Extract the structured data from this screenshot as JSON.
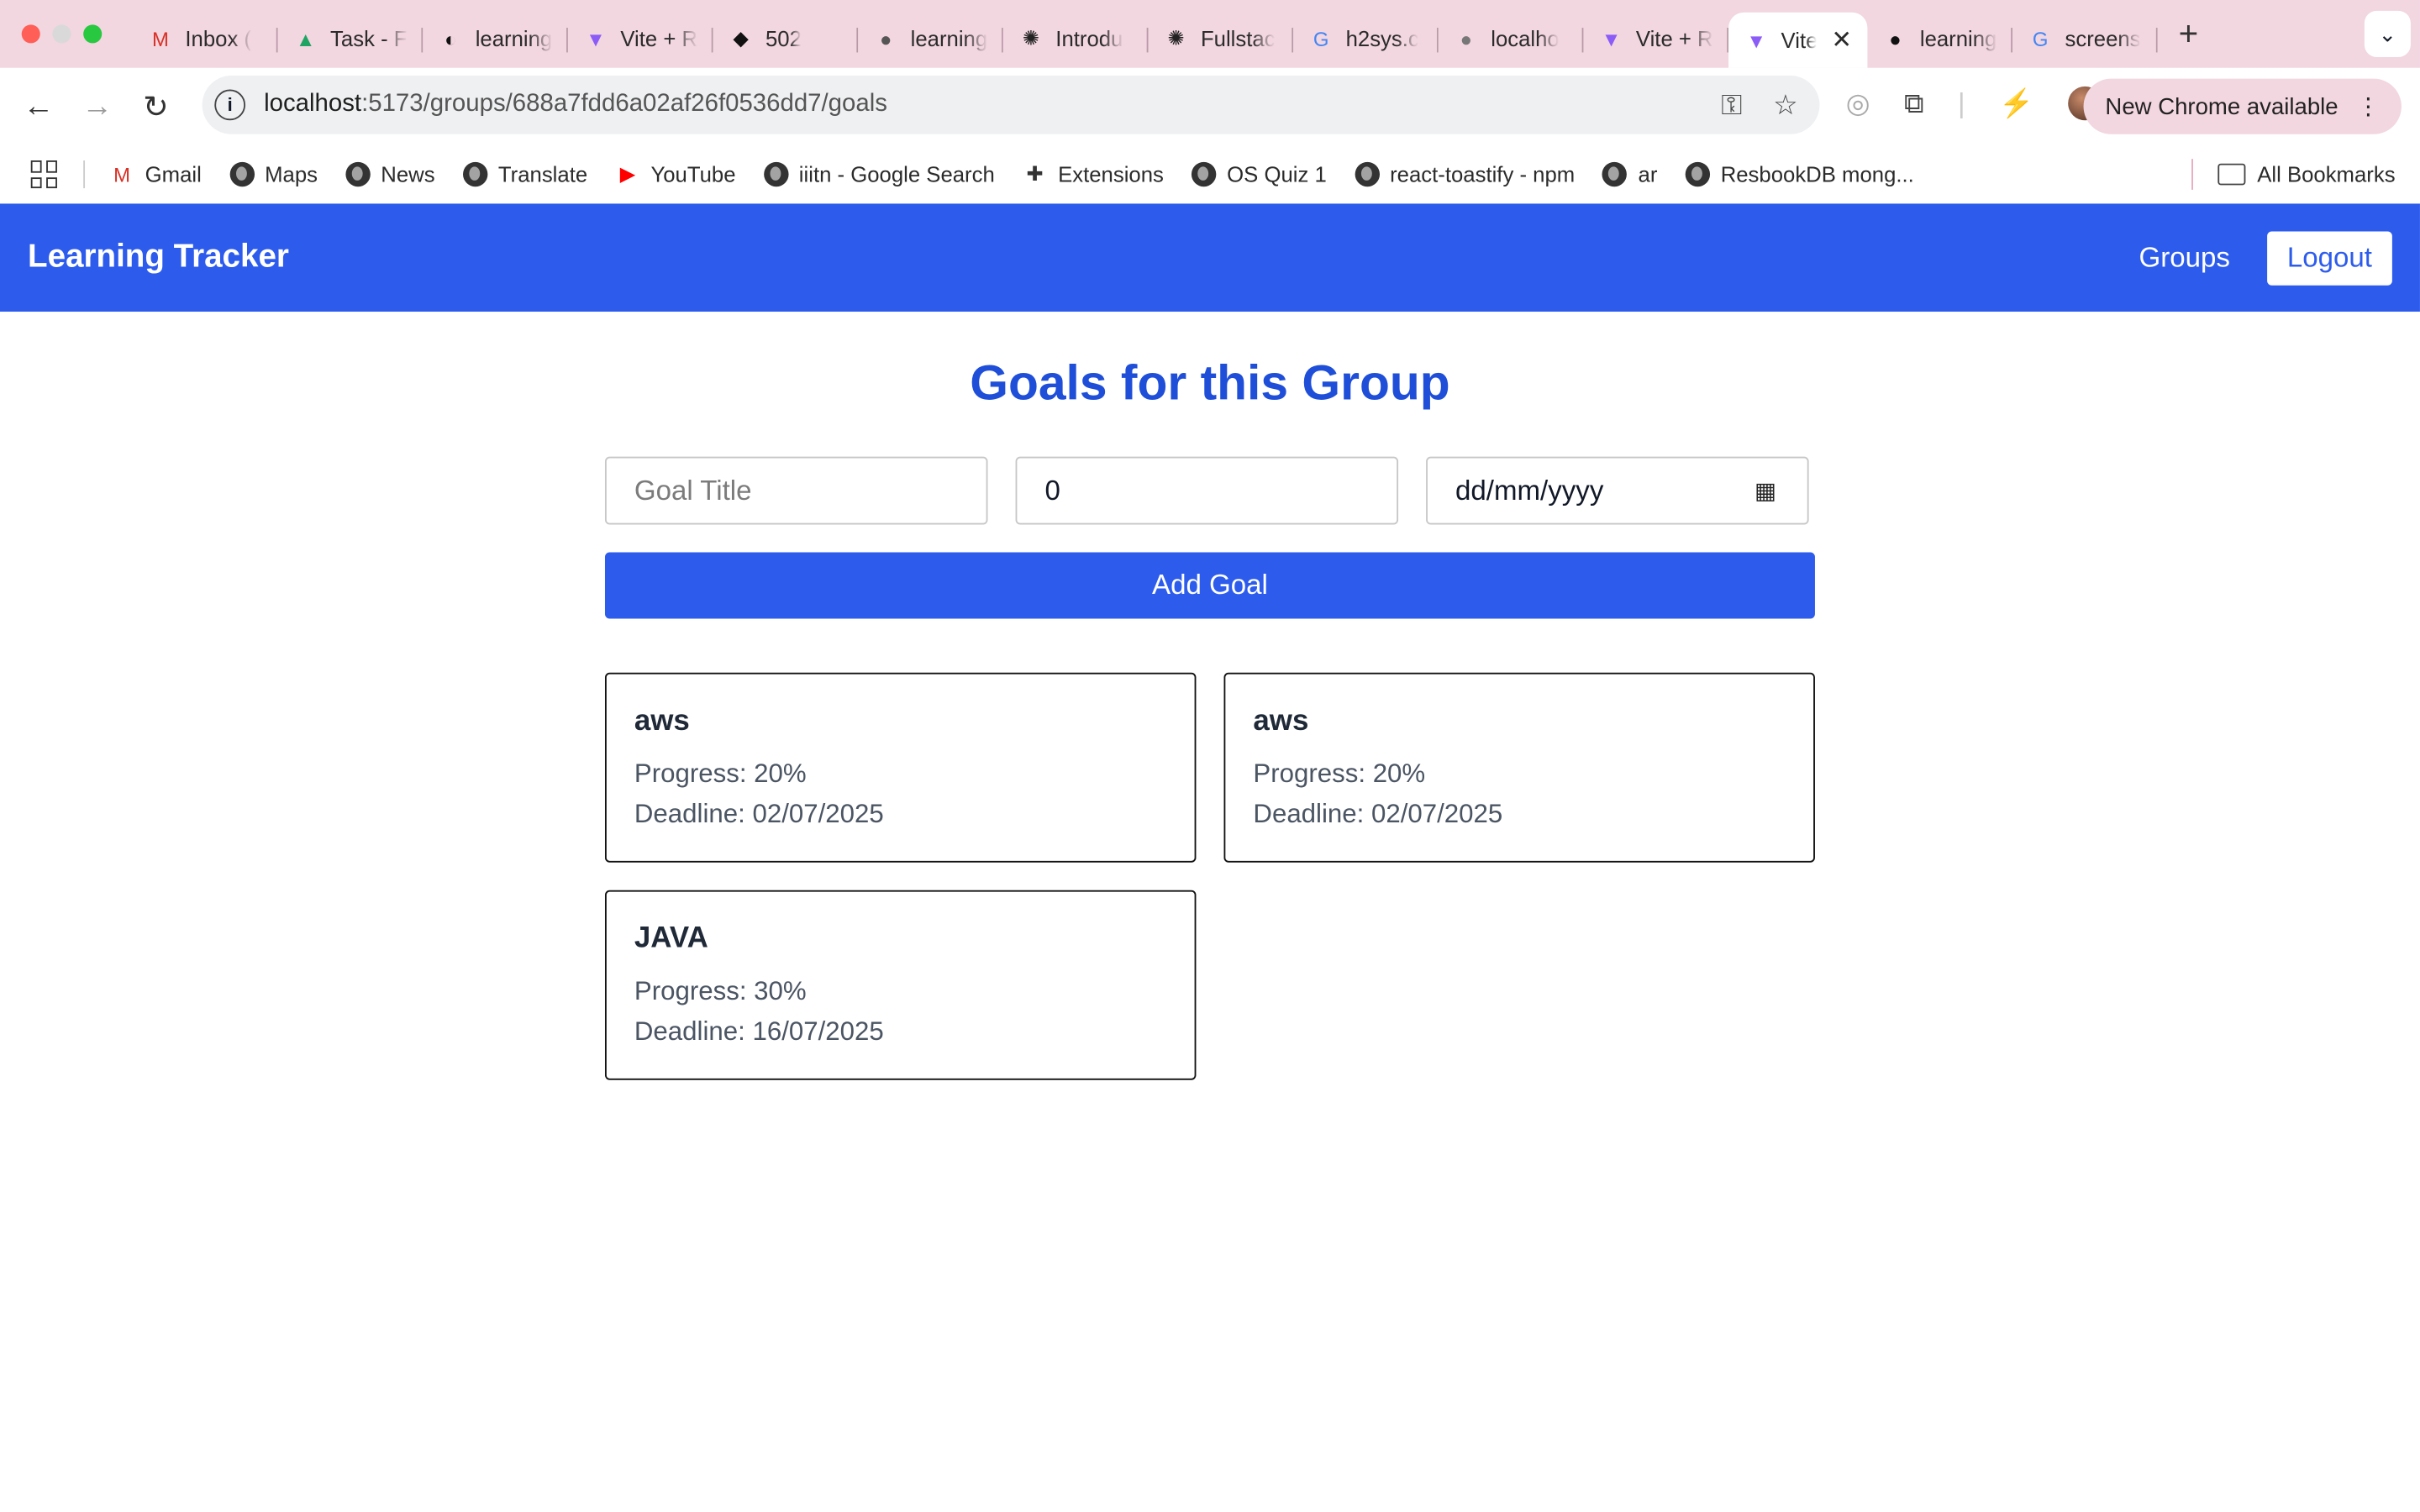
{
  "browser": {
    "tabs": [
      {
        "title": "Inbox (",
        "icon": "gmail-icon",
        "glyph": "M",
        "color": "#d93025"
      },
      {
        "title": "Task - F",
        "icon": "google-drive-icon",
        "glyph": "▲",
        "color": "#1fa463"
      },
      {
        "title": "learning",
        "icon": "site-icon",
        "glyph": "◐",
        "color": "#111111"
      },
      {
        "title": "Vite + R",
        "icon": "vite-icon",
        "glyph": "▼",
        "color": "#8b5cf6"
      },
      {
        "title": "502",
        "icon": "site-icon",
        "glyph": "◆",
        "color": "#111111"
      },
      {
        "title": "learning",
        "icon": "globe-icon",
        "glyph": "●",
        "color": "#555555"
      },
      {
        "title": "Introdu",
        "icon": "openai-icon",
        "glyph": "✺",
        "color": "#222222"
      },
      {
        "title": "Fullstac",
        "icon": "openai-icon",
        "glyph": "✺",
        "color": "#222222"
      },
      {
        "title": "h2sys.c",
        "icon": "google-icon",
        "glyph": "G",
        "color": "#4285f4"
      },
      {
        "title": "localho",
        "icon": "globe-icon",
        "glyph": "●",
        "color": "#777777"
      },
      {
        "title": "Vite + R",
        "icon": "vite-icon",
        "glyph": "▼",
        "color": "#8b5cf6"
      }
    ],
    "active_tab": {
      "title": "Vite",
      "icon": "vite-icon",
      "glyph": "▼",
      "color": "#8b5cf6"
    },
    "tabs_after": [
      {
        "title": "learning",
        "icon": "github-icon",
        "glyph": "●",
        "color": "#111111"
      },
      {
        "title": "screens",
        "icon": "google-icon",
        "glyph": "G",
        "color": "#4285f4"
      }
    ],
    "url_host": "localhost",
    "url_path": ":5173/groups/688a7fdd6a02af26f0536dd7/goals",
    "update_label": "New Chrome available",
    "bookmarks": [
      {
        "label": "Gmail",
        "icon": "gmail-icon"
      },
      {
        "label": "Maps",
        "icon": "globe-icon"
      },
      {
        "label": "News",
        "icon": "globe-icon"
      },
      {
        "label": "Translate",
        "icon": "globe-icon"
      },
      {
        "label": "YouTube",
        "icon": "youtube-icon"
      },
      {
        "label": "iiitn - Google Search",
        "icon": "globe-icon"
      },
      {
        "label": "Extensions",
        "icon": "puzzle-icon"
      },
      {
        "label": "OS Quiz 1",
        "icon": "globe-icon"
      },
      {
        "label": "react-toastify - npm",
        "icon": "globe-icon"
      },
      {
        "label": "ar",
        "icon": "globe-icon"
      },
      {
        "label": "ResbookDB mong...",
        "icon": "globe-icon"
      }
    ],
    "all_bookmarks_label": "All Bookmarks"
  },
  "app": {
    "brand": "Learning Tracker",
    "nav_groups": "Groups",
    "nav_logout": "Logout",
    "title": "Goals for this Group",
    "form": {
      "title_placeholder": "Goal Title",
      "progress_value": "0",
      "date_placeholder": "dd/mm/yyyy",
      "add_label": "Add Goal"
    },
    "goals": [
      {
        "title": "aws",
        "progress": "Progress: 20%",
        "deadline": "Deadline: 02/07/2025"
      },
      {
        "title": "aws",
        "progress": "Progress: 20%",
        "deadline": "Deadline: 02/07/2025"
      },
      {
        "title": "JAVA",
        "progress": "Progress: 30%",
        "deadline": "Deadline: 16/07/2025"
      }
    ]
  },
  "colors": {
    "primary": "#2d5ced",
    "title": "#1f4fd8",
    "tabstrip": "#f2d6e0"
  }
}
